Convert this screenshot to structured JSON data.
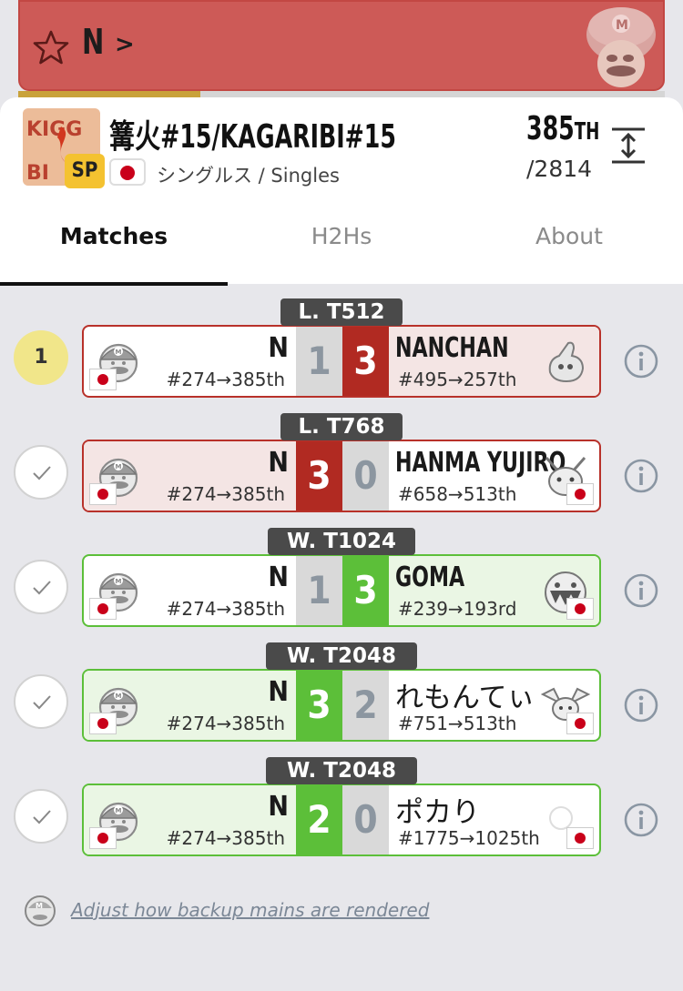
{
  "player": {
    "name": "N",
    "chevron": ">"
  },
  "tournament": {
    "name": "篝火#15/KAGARIBI#15",
    "game_badge": "SP",
    "format": "シングルス / Singles",
    "placement": "385",
    "placement_suffix": "TH",
    "entrants": "/2814"
  },
  "tabs": [
    {
      "label": "Matches"
    },
    {
      "label": "H2Hs"
    },
    {
      "label": "About"
    }
  ],
  "matches": [
    {
      "round": "L. T512",
      "status": "1",
      "left_name": "N",
      "left_rank": "#274→385th",
      "left_score": "1",
      "right_score": "3",
      "right_name": "NANCHAN",
      "right_rank": "#495→257th",
      "right_icon": "hand-character-icon",
      "result": "loss"
    },
    {
      "round": "L. T768",
      "status": "check",
      "left_name": "N",
      "left_rank": "#274→385th",
      "left_score": "3",
      "right_score": "0",
      "right_name": "HANMA YUJIRO",
      "right_rank": "#658→513th",
      "right_icon": "pikachu-icon",
      "result": "win"
    },
    {
      "round": "W. T1024",
      "status": "check",
      "left_name": "N",
      "left_rank": "#274→385th",
      "left_score": "1",
      "right_score": "3",
      "right_name": "GOMA",
      "right_rank": "#239→193rd",
      "right_icon": "king-boo-icon",
      "result": "loss"
    },
    {
      "round": "W. T2048",
      "status": "check",
      "left_name": "N",
      "left_rank": "#274→385th",
      "left_score": "3",
      "right_score": "2",
      "right_name": "れもんてぃ",
      "right_rank": "#751→513th",
      "right_icon": "pichu-icon",
      "result": "win"
    },
    {
      "round": "W. T2048",
      "status": "check",
      "left_name": "N",
      "left_rank": "#274→385th",
      "left_score": "2",
      "right_score": "0",
      "right_name": "ポカり",
      "right_rank": "#1775→1025th",
      "right_icon": "blank-character-icon",
      "result": "win"
    }
  ],
  "footer": {
    "link": "Adjust how backup mains are rendered"
  },
  "colors": {
    "header_red": "#cd5a57",
    "loss_red": "#b12a22",
    "win_green": "#5cbf39",
    "badge_yellow": "#f4c230"
  }
}
